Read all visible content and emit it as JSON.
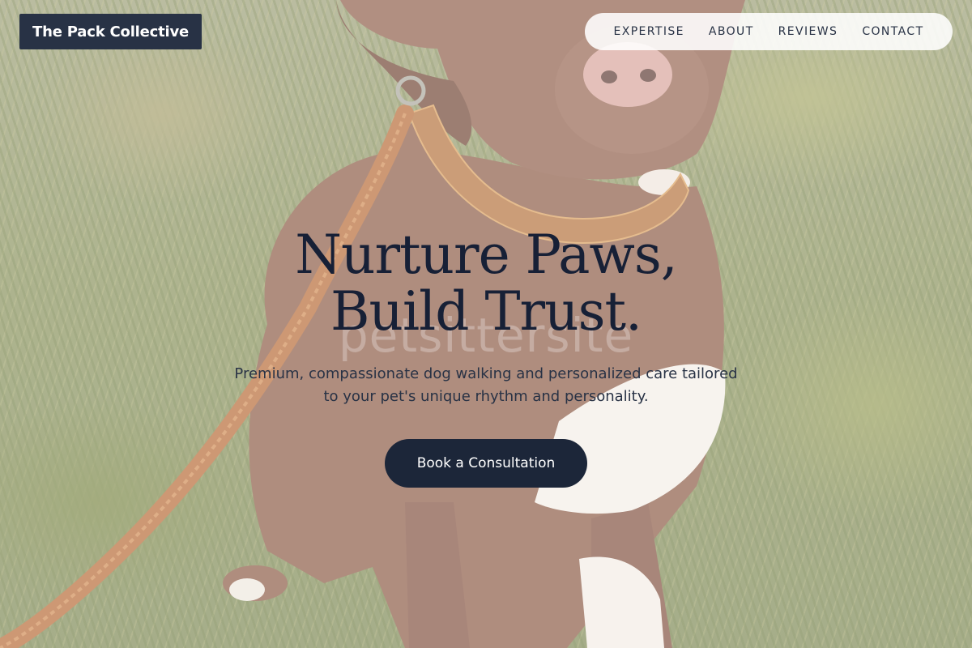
{
  "header": {
    "brand": "The Pack Collective",
    "nav": [
      {
        "label": "EXPERTISE"
      },
      {
        "label": "ABOUT"
      },
      {
        "label": "REVIEWS"
      },
      {
        "label": "CONTACT"
      }
    ]
  },
  "hero": {
    "headline_line1": "Nurture Paws,",
    "headline_line2": "Build Trust.",
    "watermark": "petsittersite",
    "subtitle_line1": "Premium, compassionate dog walking and personalized care tailored",
    "subtitle_line2": "to your pet's unique rhythm and personality.",
    "cta_label": "Book a Consultation",
    "image_subject": "brown dog with leather collar and leash sitting on grass"
  },
  "colors": {
    "brand_navy": "#283245",
    "button_navy": "#1c2639",
    "headline": "#172036",
    "nav_bg": "#ffffff"
  }
}
